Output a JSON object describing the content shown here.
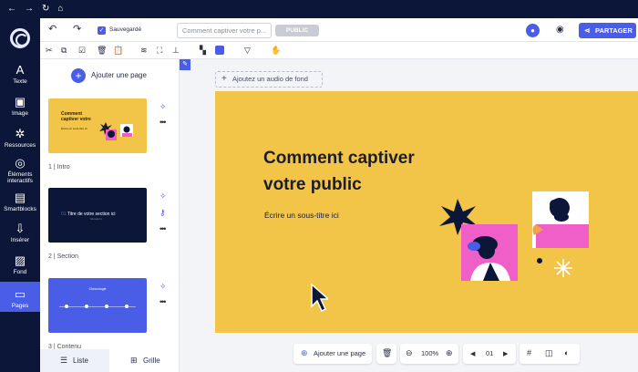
{
  "browser": {
    "nav": [
      "←",
      "→",
      "↻",
      "⌂"
    ]
  },
  "rail": {
    "items": [
      {
        "icon": "text-icon",
        "glyph": "A",
        "label": "Texte"
      },
      {
        "icon": "image-icon",
        "glyph": "▣",
        "label": "Image"
      },
      {
        "icon": "resources-icon",
        "glyph": "✲",
        "label": "Ressources"
      },
      {
        "icon": "interactive-icon",
        "glyph": "◎",
        "label": "Éléments interactifs"
      },
      {
        "icon": "smartblocks-icon",
        "glyph": "▤",
        "label": "Smartblocks"
      },
      {
        "icon": "insert-icon",
        "glyph": "⇩",
        "label": "Insérer"
      },
      {
        "icon": "background-icon",
        "glyph": "▨",
        "label": "Fond"
      },
      {
        "icon": "pages-icon",
        "glyph": "▭",
        "label": "Pages"
      }
    ],
    "active": "Pages"
  },
  "toolbar": {
    "saved_label": "Sauvegardé",
    "title_value": "Comment captiver votre p...",
    "public_label": "PUBLIC",
    "share_label": "PARTAGER"
  },
  "panel": {
    "add_page_label": "Ajouter une page",
    "pages": [
      {
        "label": "1 | Intro",
        "thumb_title": "Comment captiver votre",
        "thumb_sub": "Écrire un sous-titre ici"
      },
      {
        "label": "2 | Section",
        "thumb_number": "01",
        "thumb_title": "Titre de votre section ici",
        "thumb_sub": "Nouvelle ici"
      },
      {
        "label": "3 | Contenu",
        "thumb_title": "Chronologie"
      }
    ],
    "tabs": [
      {
        "label": "Liste",
        "icon": "list-icon"
      },
      {
        "label": "Grille",
        "icon": "grid-icon"
      }
    ],
    "active_tab": "Liste"
  },
  "canvas": {
    "audio_label": "Ajoutez un audio de fond",
    "slide": {
      "title": "Comment captiver votre public",
      "subtitle": "Écrire un sous-titre ici",
      "background": "#f2c448"
    }
  },
  "bottom_bar": {
    "add_page_label": "Ajouter une page",
    "zoom": "100%",
    "page_indicator": "01"
  },
  "colors": {
    "accent": "#4a5de6",
    "navy": "#0c1638",
    "pink": "#f05fc8",
    "orange": "#f1a24a"
  }
}
